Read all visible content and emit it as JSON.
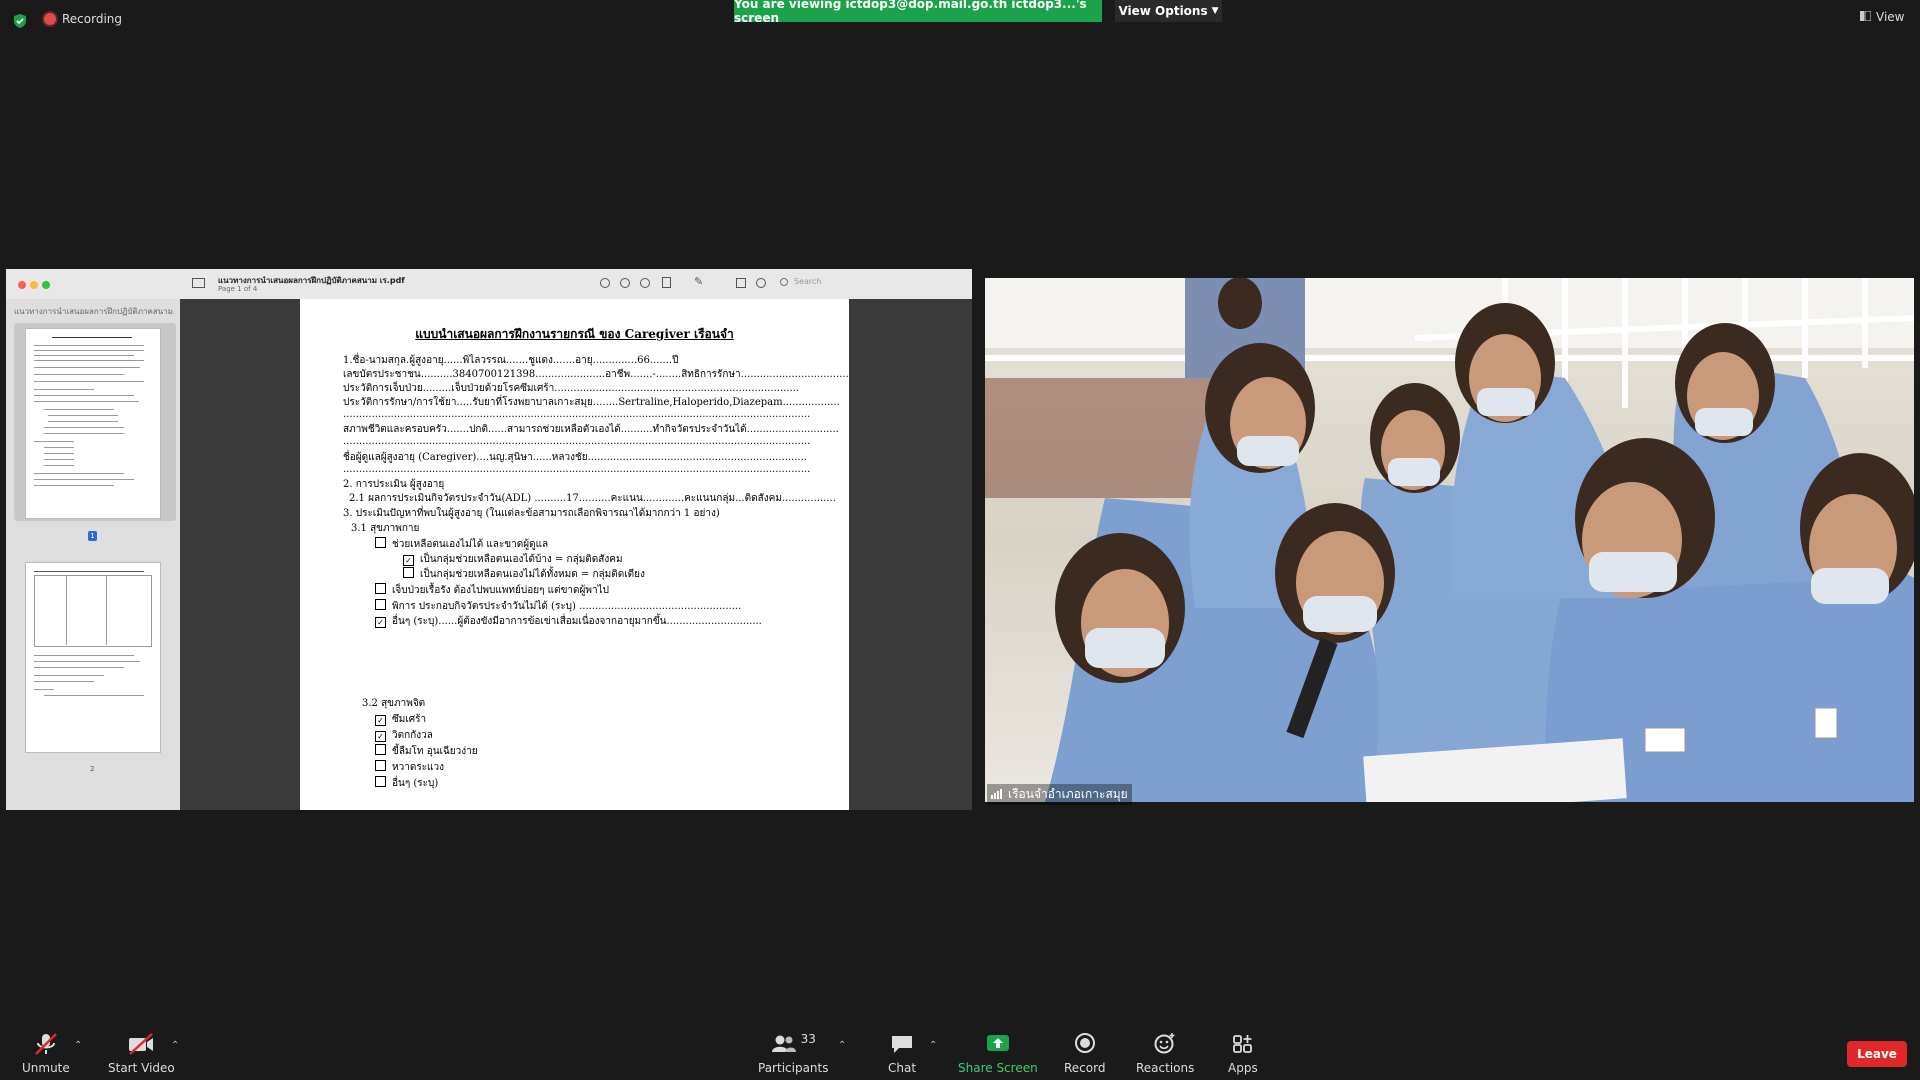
{
  "top_bar": {
    "recording_label": "Recording",
    "viewing_banner": "You are viewing ictdop3@dop.mail.go.th ictdop3...'s screen",
    "view_options_label": "View Options",
    "view_label": "View"
  },
  "shared_screen": {
    "window_title": "แนวทางการนำเสนอผลการฝึกปฏิบัติภาคสนาม เร.pdf",
    "page_indicator": "Page 1 of 4",
    "sidebar_title": "แนวทางการนำเสนอผลการฝึกปฏิบัติภาคสนาม...",
    "search_placeholder": "Search",
    "thumbnail_1_label": "1",
    "thumbnail_2_label": "2",
    "document": {
      "title": "แบบนำเสนอผลการฝึกงานรายกรณี ของ Caregiver เรือนจำ",
      "lines": [
        "1.ชื่อ-นามสกุล.ผู้สูงอายุ......พิไลวรรณ.......ชูแดง.......อายุ..............66.......ปี",
        "เลขบัตรประชาชน..........3840700121398......................อาชีพ.......-........สิทธิการรักษา..................................",
        "ประวัติการเจ็บป่วย.........เจ็บป่วยด้วยโรคซึมเศร้า.............................................................................",
        "ประวัติการรักษา/การใช้ยา.....รับยาที่โรงพยาบาลเกาะสมุย........Sertraline,Haloperido,Diazepam..................",
        "...................................................................................................................................................",
        "สภาพชีวิตและครอบครัว.......ปกติ......สามารถช่วยเหลือตัวเองได้..........ทำกิจวัตรประจำวันได้.............................",
        "...................................................................................................................................................",
        "ชื่อผู้ดูแลผู้สูงอายุ (Caregiver)....นญ.สุนิษา......หลวงชัย.....................................................................",
        "...................................................................................................................................................",
        "2. การประเมิน ผู้สูงอายุ",
        "2.1 ผลการประเมินกิจวัตรประจำวัน(ADL) ..........17..........คะแนน.............คะแนนกลุ่ม...ติดสังคม.................",
        "3. ประเมินปัญหาที่พบในผู้สูงอายุ (ในแต่ละข้อสามารถเลือกพิจารณาได้มากกว่า 1 อย่าง)",
        "3.1 สุขภาพกาย"
      ],
      "checklist": [
        {
          "checked": false,
          "text": "ช่วยเหลือตนเองไม่ได้ และขาดผู้ดูแล",
          "indent": 1
        },
        {
          "checked": true,
          "text": "เป็นกลุ่มช่วยเหลือตนเองได้บ้าง          = กลุ่มติดสังคม",
          "indent": 2
        },
        {
          "checked": false,
          "text": "เป็นกลุ่มช่วยเหลือตนเองไม่ได้ทั้งหมด  = กลุ่มติดเตียง",
          "indent": 2
        },
        {
          "checked": false,
          "text": "เจ็บป่วยเรื้อรัง ต้องไปพบแพทย์บ่อยๆ แต่ขาดผู้พาไป",
          "indent": 1
        },
        {
          "checked": false,
          "text": "พิการ ประกอบกิจวัตรประจำวันไม่ได้ (ระบุ) ...................................................",
          "indent": 1
        },
        {
          "checked": true,
          "text": "อื่นๆ (ระบุ)......ผู้ต้องขังมีอาการข้อเข่าเสื่อมเนื่องจากอายุมากขึ้น..............................",
          "indent": 1
        }
      ],
      "section_3_2": "3.2 สุขภาพจิต",
      "checklist2": [
        {
          "checked": true,
          "text": "ซึมเศร้า"
        },
        {
          "checked": true,
          "text": "วิตกกังวล"
        },
        {
          "checked": false,
          "text": "ขี้ลืมโท อุนเฉียวง่าย"
        },
        {
          "checked": false,
          "text": "หวาดระแวง"
        },
        {
          "checked": false,
          "text": "อื่นๆ (ระบุ)"
        }
      ]
    }
  },
  "video": {
    "participant_name": "เรือนจำอำเภอเกาะสมุย"
  },
  "toolbar": {
    "unmute_label": "Unmute",
    "start_video_label": "Start Video",
    "participants_label": "Participants",
    "participants_count": "33",
    "chat_label": "Chat",
    "share_screen_label": "Share Screen",
    "record_label": "Record",
    "reactions_label": "Reactions",
    "apps_label": "Apps",
    "leave_label": "Leave"
  },
  "colors": {
    "banner_green": "#1aa34a",
    "share_green": "#1aa34a",
    "leave_red": "#e02828",
    "uniform_blue": "#7ea0d0"
  }
}
